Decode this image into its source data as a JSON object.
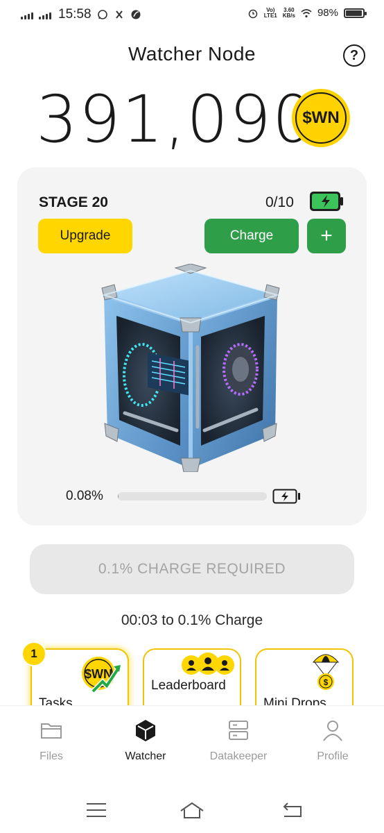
{
  "status_bar": {
    "time": "15:58",
    "network_top": "Vo)",
    "network_bottom": "LTE1",
    "speed_top": "3.60",
    "speed_bottom": "KB/s",
    "battery": "98%",
    "battery_level": 0.98
  },
  "header": {
    "title": "Watcher Node",
    "help_icon": "question-circle-icon",
    "help_label": "?"
  },
  "balance": {
    "amount": "391,090",
    "coin_label": "$WN",
    "coin_color": "#ffd200"
  },
  "node": {
    "stage": "STAGE 20",
    "charges": "0/10",
    "upgrade_label": "Upgrade",
    "charge_label": "Charge",
    "plus_label": "+",
    "charge_percent_label": "0.08%",
    "charge_fraction": 0.0008,
    "charge_required_label": "0.1% CHARGE REQUIRED",
    "timer_text": "00:03 to 0.1% Charge"
  },
  "tiles": [
    {
      "label": "Tasks",
      "badge": "1",
      "icon": "wn-coin-growth-icon"
    },
    {
      "label": "Leaderboard",
      "icon": "group-users-icon"
    },
    {
      "label": "Mini Drops",
      "icon": "parachute-coin-icon"
    }
  ],
  "bottom_nav": [
    {
      "label": "Files",
      "icon": "folder-icon",
      "active": false
    },
    {
      "label": "Watcher",
      "icon": "cube-icon",
      "active": true
    },
    {
      "label": "Datakeeper",
      "icon": "server-icon",
      "active": false
    },
    {
      "label": "Profile",
      "icon": "user-icon",
      "active": false
    }
  ],
  "colors": {
    "accent_yellow": "#ffd600",
    "accent_green": "#2e9e48",
    "card_bg": "#f4f4f4"
  }
}
